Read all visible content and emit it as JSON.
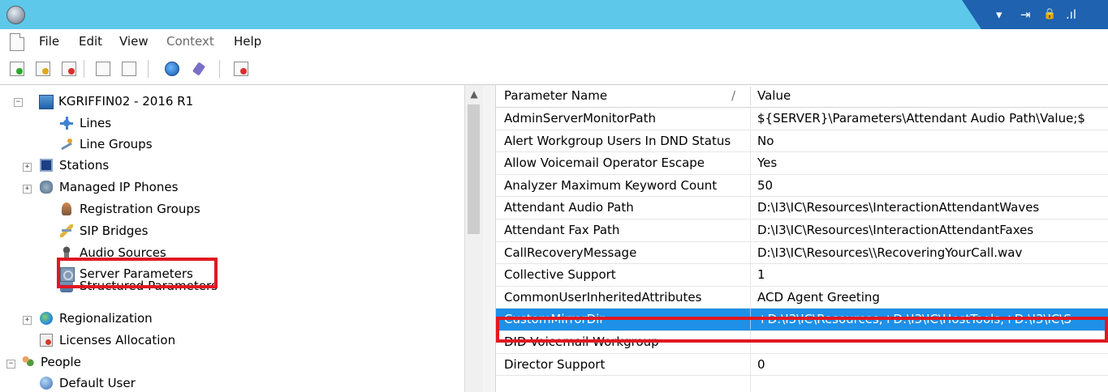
{
  "window": {
    "status_glyphs": [
      "▾",
      "⇥",
      "🔒",
      ".ıl"
    ]
  },
  "menu": {
    "items": [
      {
        "label": "File",
        "enabled": true
      },
      {
        "label": "Edit",
        "enabled": true
      },
      {
        "label": "View",
        "enabled": true
      },
      {
        "label": "Context",
        "enabled": false
      },
      {
        "label": "Help",
        "enabled": true
      }
    ]
  },
  "toolbar": {
    "buttons": [
      "add-icon",
      "edit-icon",
      "delete-icon",
      "copy-icon",
      "paste-icon",
      "globe-icon",
      "pin-icon",
      "properties-icon"
    ]
  },
  "tree": {
    "root": "KGRIFFIN02 - 2016 R1",
    "items": [
      {
        "label": "Lines",
        "icon": "lines-icon"
      },
      {
        "label": "Line Groups",
        "icon": "line-groups-icon"
      },
      {
        "label": "Stations",
        "icon": "stations-icon",
        "expandable": true
      },
      {
        "label": "Managed IP Phones",
        "icon": "ip-phone-icon",
        "expandable": true
      },
      {
        "label": "Registration Groups",
        "icon": "registration-icon"
      },
      {
        "label": "SIP Bridges",
        "icon": "sip-bridge-icon"
      },
      {
        "label": "Audio Sources",
        "icon": "audio-source-icon"
      },
      {
        "label": "Server Parameters",
        "icon": "server-parameters-icon",
        "highlighted": true
      },
      {
        "label": "Structured Parameters",
        "icon": "structured-parameters-icon"
      },
      {
        "label": "Regionalization",
        "icon": "globe-icon",
        "expandable": true
      },
      {
        "label": "Licenses Allocation",
        "icon": "license-icon"
      },
      {
        "label": "People",
        "icon": "people-icon",
        "expandable": true,
        "expanded": true
      },
      {
        "label": "Default User",
        "icon": "user-icon"
      }
    ]
  },
  "grid": {
    "columns": [
      "Parameter Name",
      "Value"
    ],
    "sort_glyph": "/",
    "rows": [
      {
        "name": "AdminServerMonitorPath",
        "value": "${SERVER}\\Parameters\\Attendant Audio Path\\Value;$"
      },
      {
        "name": "Alert Workgroup Users In DND Status",
        "value": "No"
      },
      {
        "name": "Allow Voicemail Operator Escape",
        "value": "Yes"
      },
      {
        "name": "Analyzer Maximum Keyword Count",
        "value": "50"
      },
      {
        "name": "Attendant Audio Path",
        "value": "D:\\I3\\IC\\Resources\\InteractionAttendantWaves"
      },
      {
        "name": "Attendant Fax Path",
        "value": "D:\\I3\\IC\\Resources\\InteractionAttendantFaxes"
      },
      {
        "name": "CallRecoveryMessage",
        "value": "D:\\I3\\IC\\Resources\\\\RecoveringYourCall.wav"
      },
      {
        "name": "Collective Support",
        "value": "1"
      },
      {
        "name": "CommonUserInheritedAttributes",
        "value": "ACD Agent Greeting"
      },
      {
        "name": "CustomMirrorDir",
        "value": "+D:\\I3\\IC\\Resources;+D:\\I3\\IC\\HostTools;+D:\\I3\\IC\\S",
        "selected": true
      },
      {
        "name": "DID Voicemail Workgroup",
        "value": ""
      },
      {
        "name": "Director Support",
        "value": "0"
      },
      {
        "name": "",
        "value": ""
      }
    ]
  },
  "colors": {
    "titlebar": "#5ec8ea",
    "status_tab": "#1e62b0",
    "selection": "#1e90e8",
    "highlight_box": "#e01821"
  }
}
